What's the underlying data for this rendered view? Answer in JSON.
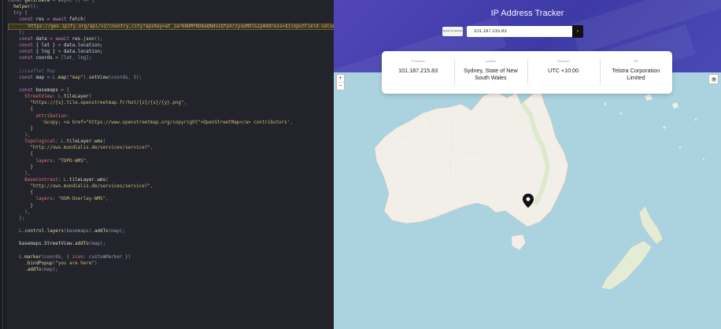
{
  "editor": {
    "lines": [
      [
        {
          "t": "const ",
          "c": "k"
        },
        {
          "t": "getIPData",
          "c": "f"
        },
        {
          "t": " = async () => {",
          "c": "o"
        }
      ],
      [
        {
          "t": "  helper",
          "c": "f"
        },
        {
          "t": "();",
          "c": "o"
        }
      ],
      [
        {
          "t": "  try ",
          "c": "k"
        },
        {
          "t": "{",
          "c": "o"
        }
      ],
      [
        {
          "t": "    const ",
          "c": "k"
        },
        {
          "t": "res",
          "c": "v"
        },
        {
          "t": " = ",
          "c": "o"
        },
        {
          "t": "await ",
          "c": "k"
        },
        {
          "t": "fetch",
          "c": "f"
        },
        {
          "t": "(",
          "c": "o"
        }
      ],
      [
        {
          "t": "      `https://geo.ipify.org/api/v2/country,city?apiKey=at_1ar6ADMYKDmaQNdo1QfpXr2yuuMXl&ipAddress=${inputField.value}`",
          "c": "s",
          "hl": true
        }
      ],
      [
        {
          "t": "    );",
          "c": "o"
        }
      ],
      [
        {
          "t": "    const ",
          "c": "k"
        },
        {
          "t": "data",
          "c": "v"
        },
        {
          "t": " = ",
          "c": "o"
        },
        {
          "t": "await ",
          "c": "k"
        },
        {
          "t": "res.",
          "c": "v"
        },
        {
          "t": "json",
          "c": "f"
        },
        {
          "t": "();",
          "c": "o"
        }
      ],
      [
        {
          "t": "    const ",
          "c": "k"
        },
        {
          "t": "{ lat }",
          "c": "v"
        },
        {
          "t": " = ",
          "c": "o"
        },
        {
          "t": "data.location;",
          "c": "v"
        }
      ],
      [
        {
          "t": "    const ",
          "c": "k"
        },
        {
          "t": "{ lng }",
          "c": "v"
        },
        {
          "t": " = ",
          "c": "o"
        },
        {
          "t": "data.location;",
          "c": "v"
        }
      ],
      [
        {
          "t": "    const ",
          "c": "k"
        },
        {
          "t": "coords",
          "c": "v"
        },
        {
          "t": " = [lat, lng];",
          "c": "o"
        }
      ],
      [
        {
          "t": "",
          "c": "o"
        }
      ],
      [
        {
          "t": "    //Leaflet Map",
          "c": "c"
        }
      ],
      [
        {
          "t": "    const ",
          "c": "k"
        },
        {
          "t": "map",
          "c": "v"
        },
        {
          "t": " = L.",
          "c": "o"
        },
        {
          "t": "map",
          "c": "f"
        },
        {
          "t": "(",
          "c": "o"
        },
        {
          "t": "\"map\"",
          "c": "s"
        },
        {
          "t": ").",
          "c": "o"
        },
        {
          "t": "setView",
          "c": "f"
        },
        {
          "t": "(coords, 5);",
          "c": "o"
        }
      ],
      [
        {
          "t": "",
          "c": "o"
        }
      ],
      [
        {
          "t": "    const ",
          "c": "k"
        },
        {
          "t": "basemaps",
          "c": "v"
        },
        {
          "t": " = {",
          "c": "o"
        }
      ],
      [
        {
          "t": "      StreetView",
          "c": "r"
        },
        {
          "t": ": L.",
          "c": "o"
        },
        {
          "t": "tileLayer",
          "c": "f"
        },
        {
          "t": "(",
          "c": "o"
        }
      ],
      [
        {
          "t": "        \"https://{s}.tile.openstreetmap.fr/hot/{z}/{x}/{y}.png\"",
          "c": "s"
        },
        {
          "t": ",",
          "c": "o"
        }
      ],
      [
        {
          "t": "        {",
          "c": "p"
        }
      ],
      [
        {
          "t": "          attribution",
          "c": "r"
        },
        {
          "t": ":",
          "c": "o"
        }
      ],
      [
        {
          "t": "            '&copy; <a href=\"https://www.openstreetmap.org/copyright\">OpenStreetMap</a> contributors'",
          "c": "s"
        },
        {
          "t": ",",
          "c": "o"
        }
      ],
      [
        {
          "t": "        }",
          "c": "p"
        }
      ],
      [
        {
          "t": "      ),",
          "c": "o"
        }
      ],
      [
        {
          "t": "      Topological",
          "c": "r"
        },
        {
          "t": ": L.",
          "c": "o"
        },
        {
          "t": "tileLayer",
          "c": "f"
        },
        {
          "t": ".",
          "c": "o"
        },
        {
          "t": "wms",
          "c": "f"
        },
        {
          "t": "(",
          "c": "o"
        }
      ],
      [
        {
          "t": "        \"http://ows.mundialis.de/services/service?\"",
          "c": "s"
        },
        {
          "t": ",",
          "c": "o"
        }
      ],
      [
        {
          "t": "        {",
          "c": "p"
        }
      ],
      [
        {
          "t": "          layers",
          "c": "r"
        },
        {
          "t": ": ",
          "c": "o"
        },
        {
          "t": "\"TOPO-WMS\"",
          "c": "s"
        },
        {
          "t": ",",
          "c": "o"
        }
      ],
      [
        {
          "t": "        }",
          "c": "p"
        }
      ],
      [
        {
          "t": "      ),",
          "c": "o"
        }
      ],
      [
        {
          "t": "      BaseContrast",
          "c": "r"
        },
        {
          "t": ": L.",
          "c": "o"
        },
        {
          "t": "tileLayer",
          "c": "f"
        },
        {
          "t": ".",
          "c": "o"
        },
        {
          "t": "wms",
          "c": "f"
        },
        {
          "t": "(",
          "c": "o"
        }
      ],
      [
        {
          "t": "        \"http://ows.mundialis.de/services/service?\"",
          "c": "s"
        },
        {
          "t": ",",
          "c": "o"
        }
      ],
      [
        {
          "t": "        {",
          "c": "p"
        }
      ],
      [
        {
          "t": "          layers",
          "c": "r"
        },
        {
          "t": ": ",
          "c": "o"
        },
        {
          "t": "\"OSM-Overlay-WMS\"",
          "c": "s"
        },
        {
          "t": ",",
          "c": "o"
        }
      ],
      [
        {
          "t": "        }",
          "c": "p"
        }
      ],
      [
        {
          "t": "      ),",
          "c": "o"
        }
      ],
      [
        {
          "t": "    };",
          "c": "o"
        }
      ],
      [
        {
          "t": "",
          "c": "o"
        }
      ],
      [
        {
          "t": "    L.",
          "c": "o"
        },
        {
          "t": "control",
          "c": "f"
        },
        {
          "t": ".",
          "c": "o"
        },
        {
          "t": "layers",
          "c": "f"
        },
        {
          "t": "(basemaps).",
          "c": "o"
        },
        {
          "t": "addTo",
          "c": "f"
        },
        {
          "t": "(map);",
          "c": "o"
        }
      ],
      [
        {
          "t": "",
          "c": "o"
        }
      ],
      [
        {
          "t": "    basemaps.StreetView.",
          "c": "v"
        },
        {
          "t": "addTo",
          "c": "f"
        },
        {
          "t": "(map);",
          "c": "o"
        }
      ],
      [
        {
          "t": "",
          "c": "o"
        }
      ],
      [
        {
          "t": "    L.",
          "c": "o"
        },
        {
          "t": "marker",
          "c": "f"
        },
        {
          "t": "(coords, { ",
          "c": "o"
        },
        {
          "t": "icon",
          "c": "r"
        },
        {
          "t": ": customMarker })",
          "c": "o"
        }
      ],
      [
        {
          "t": "      .",
          "c": "o"
        },
        {
          "t": "bindPopup",
          "c": "f"
        },
        {
          "t": "(",
          "c": "o"
        },
        {
          "t": "\"you are here\"",
          "c": "s"
        },
        {
          "t": ")",
          "c": "o"
        }
      ],
      [
        {
          "t": "      .",
          "c": "o"
        },
        {
          "t": "addTo",
          "c": "f"
        },
        {
          "t": "(map);",
          "c": "o"
        }
      ]
    ]
  },
  "app": {
    "title": "IP Address Tracker",
    "search": {
      "select_label": "Search by address",
      "value": "101.187.215.83",
      "go_symbol": "›"
    },
    "info": [
      {
        "label": "IP Address",
        "value": "101.187.215.83"
      },
      {
        "label": "Location",
        "value": "Sydney, State of New South Wales"
      },
      {
        "label": "Timezone",
        "value": "UTC +10:00"
      },
      {
        "label": "ISP",
        "value": "Telstra Corporation Limited"
      }
    ],
    "map": {
      "zoom_in": "+",
      "zoom_out": "−",
      "layers_icon": "layers-icon",
      "marker_icon": "location-pin-icon",
      "land_color": "#f2efe9",
      "water_color": "#aad3df",
      "park_color": "#d6e8c4"
    }
  }
}
